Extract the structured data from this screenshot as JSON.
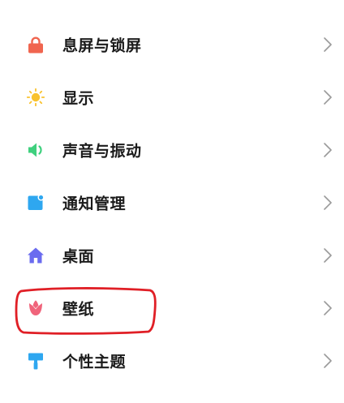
{
  "settings": {
    "items": [
      {
        "label": "息屏与锁屏",
        "icon": "lock-icon",
        "color": "#F0654F"
      },
      {
        "label": "显示",
        "icon": "sun-icon",
        "color": "#F9C22E"
      },
      {
        "label": "声音与振动",
        "icon": "speaker-icon",
        "color": "#3FD07E"
      },
      {
        "label": "通知管理",
        "icon": "notification-icon",
        "color": "#2EA7F0"
      },
      {
        "label": "桌面",
        "icon": "home-icon",
        "color": "#6A6BEF"
      },
      {
        "label": "壁纸",
        "icon": "tulip-icon",
        "color": "#F0647B"
      },
      {
        "label": "个性主题",
        "icon": "paint-roller-icon",
        "color": "#2EA7F0"
      }
    ],
    "chevron_icon": "chevron-right-icon",
    "chevron_color": "#9a9a9a"
  },
  "annotation": {
    "highlight_color": "#E01F26"
  }
}
